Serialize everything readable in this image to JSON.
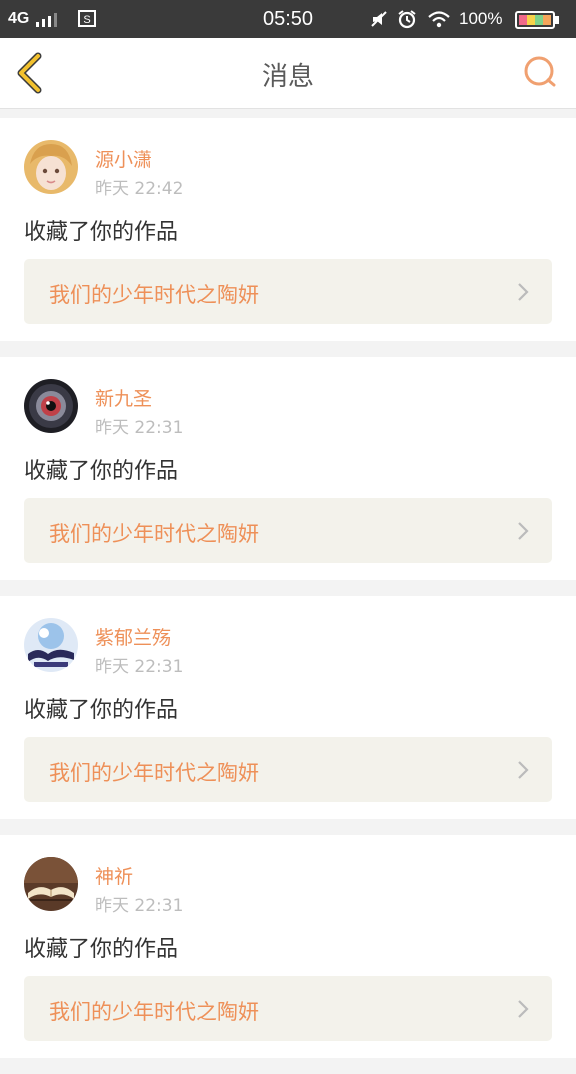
{
  "status_bar": {
    "network": "4G",
    "time": "05:50",
    "battery_percent": "100%"
  },
  "header": {
    "title": "消息",
    "back_icon": "chevron-left-icon",
    "search_icon": "search-icon",
    "accent_color": "#f2c12e",
    "search_color": "#f0a070"
  },
  "colors": {
    "name": "#ee9058",
    "link_background": "#f3f2eb",
    "divider": "#f3f3f3"
  },
  "messages": [
    {
      "user": "源小潇",
      "time": "昨天 22:42",
      "action": "收藏了你的作品",
      "work_title": "我们的少年时代之陶妍",
      "avatar": "portrait-avatar"
    },
    {
      "user": "新九圣",
      "time": "昨天 22:31",
      "action": "收藏了你的作品",
      "work_title": "我们的少年时代之陶妍",
      "avatar": "eye-avatar"
    },
    {
      "user": "紫郁兰殇",
      "time": "昨天 22:31",
      "action": "收藏了你的作品",
      "work_title": "我们的少年时代之陶妍",
      "avatar": "game-logo-avatar"
    },
    {
      "user": "神祈",
      "time": "昨天 22:31",
      "action": "收藏了你的作品",
      "work_title": "我们的少年时代之陶妍",
      "avatar": "book-avatar"
    }
  ]
}
